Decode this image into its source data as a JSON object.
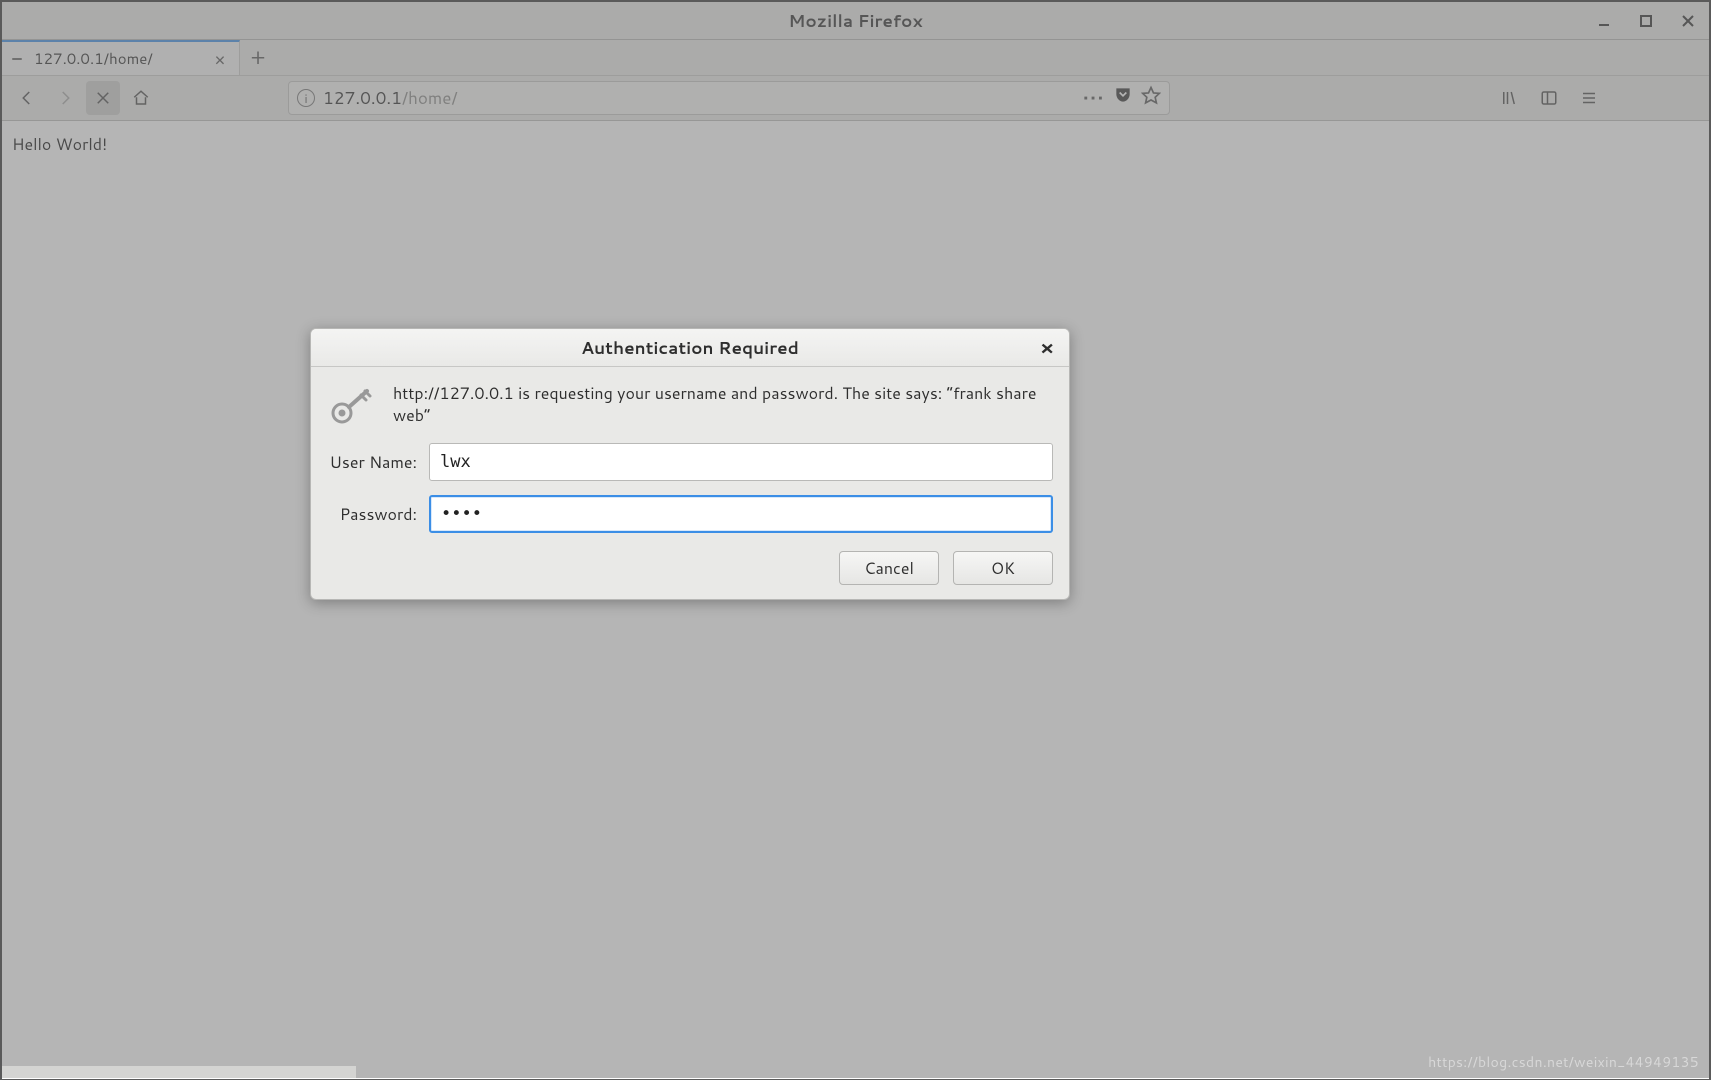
{
  "window": {
    "title": "Mozilla Firefox"
  },
  "tab": {
    "label": "127.0.0.1/home/"
  },
  "url": {
    "host": "127.0.0.1",
    "path": "/home/"
  },
  "page": {
    "body_text": "Hello World!"
  },
  "dialog": {
    "title": "Authentication Required",
    "message": "http://127.0.0.1 is requesting your username and password. The site says: “frank share web”",
    "username_label": "User Name:",
    "password_label": "Password:",
    "username_value": "lwx",
    "password_mask": "••••",
    "cancel_label": "Cancel",
    "ok_label": "OK"
  },
  "watermark": "https://blog.csdn.net/weixin_44949135"
}
